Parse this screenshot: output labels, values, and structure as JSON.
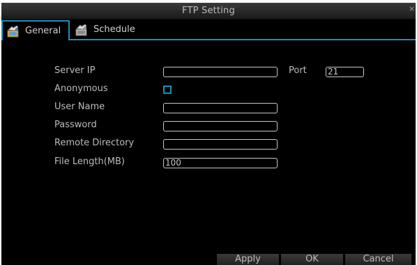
{
  "window": {
    "title": "FTP Setting",
    "close_glyph": "×"
  },
  "tabs": [
    {
      "label": "General",
      "icon": "general-settings-icon",
      "active": true
    },
    {
      "label": "Schedule",
      "icon": "schedule-icon",
      "active": false
    }
  ],
  "form": {
    "server_ip_label": "Server IP",
    "server_ip_value": "",
    "port_label": "Port",
    "port_value": "21",
    "anonymous_label": "Anonymous",
    "anonymous_checked": false,
    "user_name_label": "User Name",
    "user_name_value": "",
    "password_label": "Password",
    "password_value": "",
    "remote_directory_label": "Remote Directory",
    "remote_directory_value": "",
    "file_length_label": "File Length(MB)",
    "file_length_value": "100"
  },
  "buttons": {
    "apply": "Apply",
    "ok": "OK",
    "cancel": "Cancel"
  },
  "colors": {
    "accent": "#1f8fb8",
    "background": "#000000",
    "text": "#c8c8c8"
  }
}
